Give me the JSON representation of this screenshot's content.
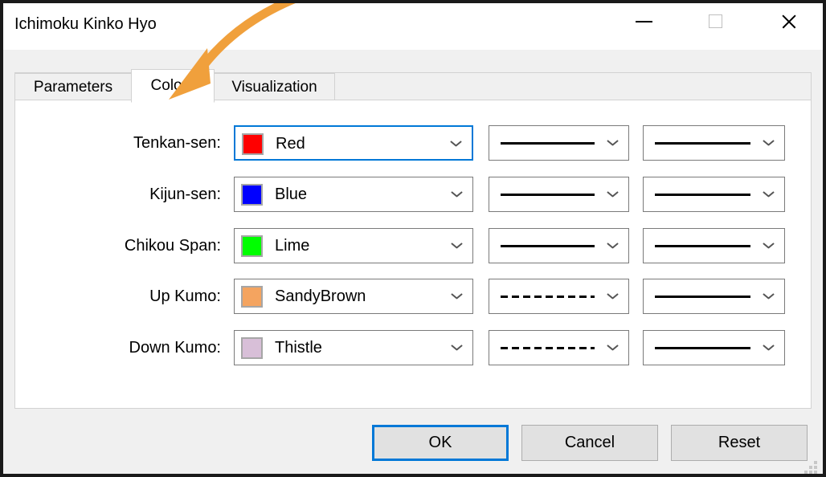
{
  "window": {
    "title": "Ichimoku Kinko Hyo",
    "caption_buttons": [
      {
        "name": "minimize",
        "glyph": "minimize-icon"
      },
      {
        "name": "maximize",
        "glyph": "maximize-icon"
      },
      {
        "name": "close",
        "glyph": "close-icon"
      }
    ]
  },
  "tabs": [
    {
      "label": "Parameters",
      "active": false
    },
    {
      "label": "Colors",
      "active": true
    },
    {
      "label": "Visualization",
      "active": false
    }
  ],
  "colors_tab": {
    "rows": [
      {
        "label": "Tenkan-sen:",
        "color_name": "Red",
        "color_hex": "#FF0000",
        "focused": true,
        "style_primary": "solid",
        "style_secondary": "solid"
      },
      {
        "label": "Kijun-sen:",
        "color_name": "Blue",
        "color_hex": "#0000FF",
        "focused": false,
        "style_primary": "solid",
        "style_secondary": "solid"
      },
      {
        "label": "Chikou Span:",
        "color_name": "Lime",
        "color_hex": "#00FF00",
        "focused": false,
        "style_primary": "solid",
        "style_secondary": "solid"
      },
      {
        "label": "Up Kumo:",
        "color_name": "SandyBrown",
        "color_hex": "#F4A460",
        "focused": false,
        "style_primary": "dashed",
        "style_secondary": "solid"
      },
      {
        "label": "Down Kumo:",
        "color_name": "Thistle",
        "color_hex": "#D8BFD8",
        "focused": false,
        "style_primary": "dashed",
        "style_secondary": "solid"
      }
    ]
  },
  "footer": {
    "ok_label": "OK",
    "cancel_label": "Cancel",
    "reset_label": "Reset"
  },
  "annotation": {
    "arrow_color": "#F0A03C",
    "points_to": "Colors"
  },
  "theme": {
    "accent": "#0078D7",
    "dialog_bg": "#F0F0F0",
    "panel_bg": "#FFFFFF",
    "border": "#D2D2D2",
    "control_border": "#7A7A7A",
    "button_bg": "#E1E1E1"
  }
}
